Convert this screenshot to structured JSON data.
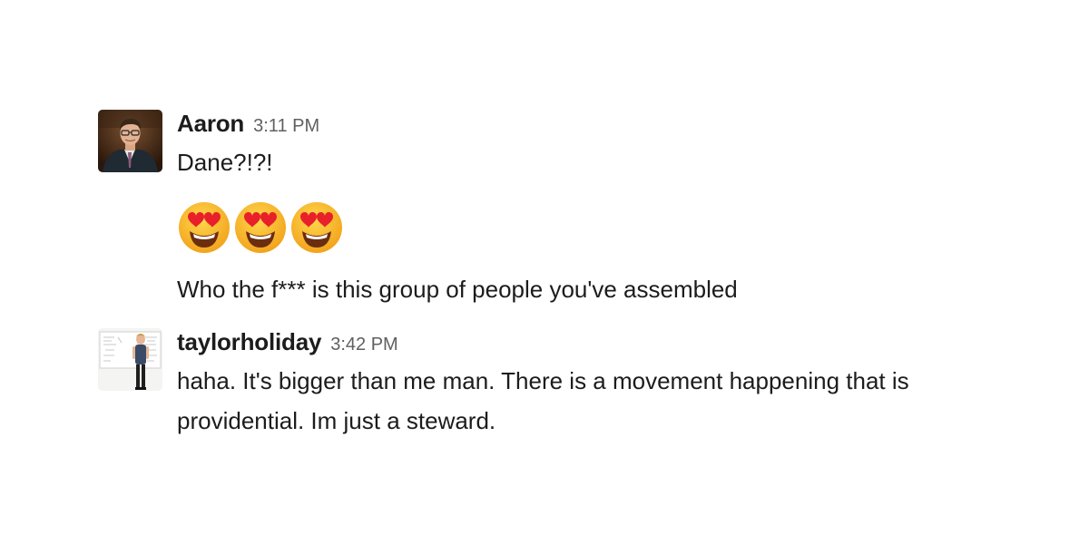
{
  "messages": [
    {
      "author": "Aaron",
      "time": "3:11 PM",
      "lines": [
        "Dane?!?!",
        "Who the f*** is this group of people you've assembled"
      ],
      "emoji": [
        "heart-eyes-emoji",
        "heart-eyes-emoji",
        "heart-eyes-emoji"
      ]
    },
    {
      "author": "taylorholiday",
      "time": "3:42 PM",
      "text": "haha. It's bigger than me man. There is a movement happening that is providential. Im just a steward."
    }
  ],
  "colors": {
    "text": "#1d1c1d",
    "timestamp": "#616061",
    "emoji_face": "#f7b52c",
    "emoji_heart": "#e8202a"
  }
}
